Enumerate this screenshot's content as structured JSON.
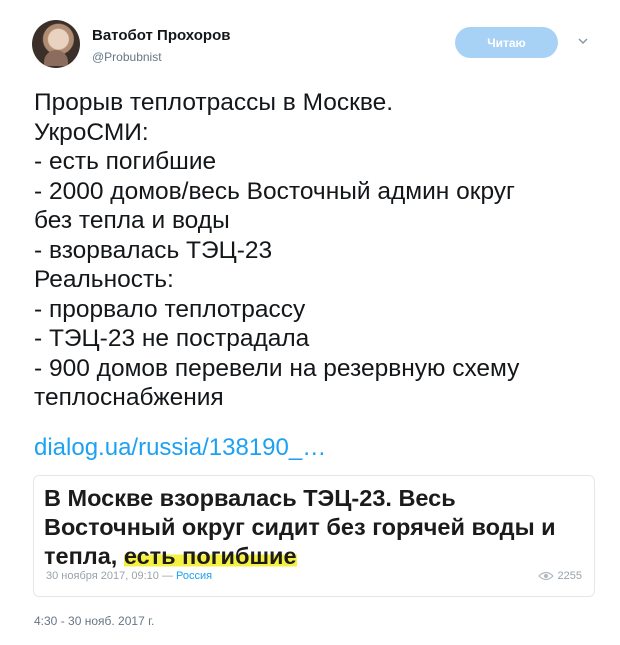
{
  "author": {
    "name": "Ватобот Прохоров",
    "handle": "@Probubnist"
  },
  "follow_button": {
    "label": "Читаю",
    "color": "#a8d2f5"
  },
  "tweet": {
    "text": "Прорыв теплотрассы в Москве.\nУкроСМИ:\n- есть погибшие\n- 2000 домов/весь Восточный админ округ\nбез тепла и воды\n- взорвалась ТЭЦ-23\nРеальность:\n- прорвало теплотрассу\n- ТЭЦ-23 не пострадала\n- 900 домов перевели на резервную схему\nтеплоснабжения",
    "link": "dialog.ua/russia/138190_…",
    "timestamp": "4:30 - 30 нояб. 2017 г."
  },
  "card": {
    "title_plain": "В Москве взорвалась ТЭЦ-23. Весь Восточный округ сидит без горячей воды и тепла,",
    "title_highlight": "есть погибшие",
    "highlight_color": "#f5f042",
    "date": "30 ноября 2017, 09:10",
    "separator": " — ",
    "category": "Россия",
    "views": "2255",
    "views_icon": "eye-icon"
  },
  "colors": {
    "link": "#1da1f2",
    "muted": "#657786"
  }
}
